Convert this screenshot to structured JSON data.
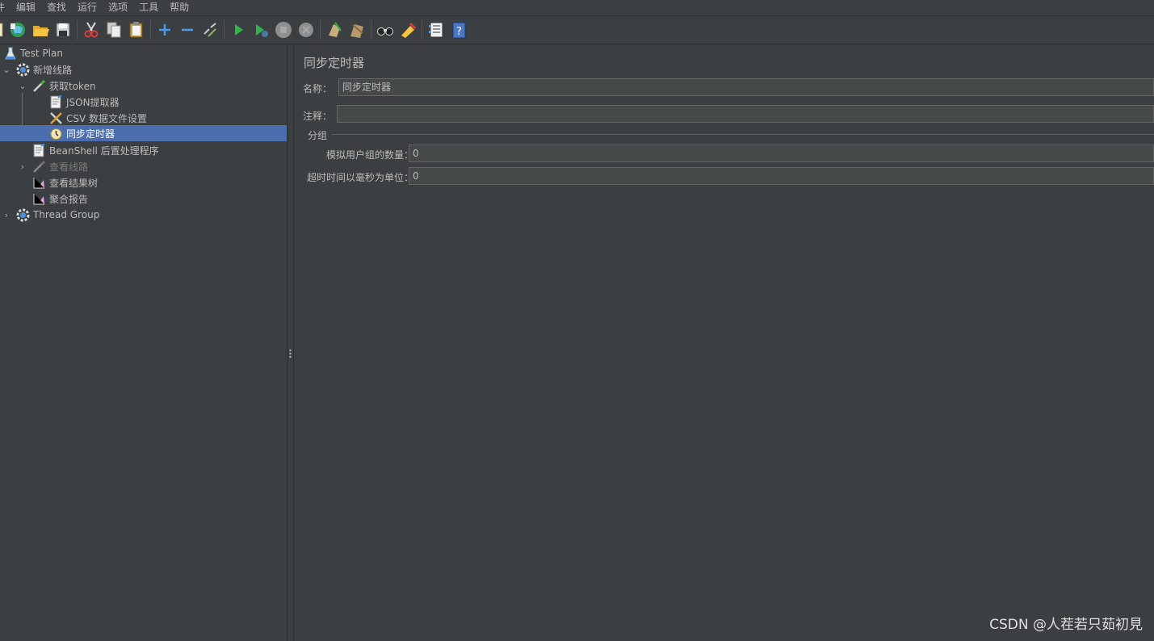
{
  "menu": [
    "件",
    "编辑",
    "查找",
    "运行",
    "选项",
    "工具",
    "帮助"
  ],
  "toolbar": {
    "icons": [
      "new-icon",
      "templates-icon",
      "open-icon",
      "save-icon",
      "cut-icon",
      "copy-icon",
      "paste-icon",
      "expand-icon",
      "collapse-icon",
      "toggle-icon",
      "start-icon",
      "start-no-pause-icon",
      "stop-icon",
      "shutdown-icon",
      "clear-icon",
      "clear-all-icon",
      "search-icon",
      "reset-search-icon",
      "function-helper-icon",
      "help-icon"
    ]
  },
  "tree": {
    "test_plan": "Test Plan",
    "thread_group_1": "新增线路",
    "sampler_token": "获取token",
    "json_extractor": "JSON提取器",
    "csv_config": "CSV 数据文件设置",
    "sync_timer": "同步定时器",
    "beanshell": "BeanShell 后置处理程序",
    "view_route": "查看线路",
    "view_results_tree": "查看结果树",
    "aggregate_report": "聚合报告",
    "thread_group_2": "Thread Group"
  },
  "panel": {
    "title": "同步定时器",
    "name_label": "名称：",
    "name_value": "同步定时器",
    "comment_label": "注释：",
    "comment_value": "",
    "group_label": "分组",
    "users_label": "模拟用户组的数量：",
    "users_value": "0",
    "timeout_label": "超时时间以毫秒为单位：",
    "timeout_value": "0"
  },
  "watermark": "CSDN @人�europe若只茹初見",
  "colors": {
    "background": "#3c3f41",
    "selection": "#4b6eaf",
    "text": "#bbbbbb"
  }
}
